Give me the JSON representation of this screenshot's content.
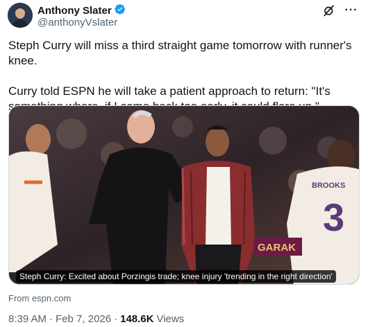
{
  "author": {
    "display_name": "Anthony Slater",
    "handle": "@anthonyVslater",
    "verified": true
  },
  "icons": {
    "verified": "verified-badge-icon",
    "grok": "grok-icon",
    "more": "more-options-icon"
  },
  "tweet": {
    "paragraph_1": "Steph Curry will miss a third straight game tomorrow with runner's knee.",
    "paragraph_2": "Curry told ESPN he will take a patient approach to return: \"It's something where, if I come back too early, it could flare up.\""
  },
  "card": {
    "caption": "Steph Curry: Excited about Porzingis trade; knee injury 'trending in the right direction'",
    "source": "From espn.com",
    "jersey_number": "3",
    "jersey_text": "BROOKS",
    "banner_text": "GARAK"
  },
  "meta": {
    "time": "8:39 AM",
    "separator": "·",
    "date": "Feb 7, 2026",
    "views_count": "148.6K",
    "views_label": "Views"
  },
  "colors": {
    "verified_blue": "#1d9bf0",
    "secondary_text": "#536471",
    "primary_text": "#0f1419"
  }
}
